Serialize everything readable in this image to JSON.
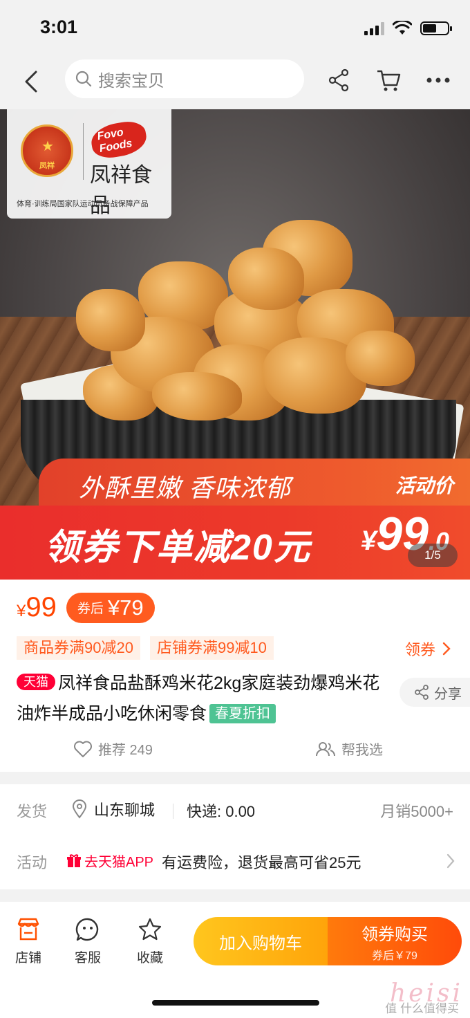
{
  "status_bar": {
    "time": "3:01",
    "battery_level": 0.55
  },
  "nav": {
    "search_placeholder": "搜索宝贝"
  },
  "icons": {
    "back": "chevron-left-icon",
    "search": "search-icon",
    "share": "share-icon",
    "cart": "cart-icon",
    "more": "more-icon"
  },
  "hero": {
    "brand_logo_en": "Fovo Foods",
    "brand_emblem_text": "凤祥",
    "brand_name": "凤祥食品",
    "brand_tagline": "体育·训练局国家队运动员备战保障产品",
    "slogan": "外酥里嫩 香味浓郁",
    "promo_label": "活动价",
    "coupon_text": "领券下单减20元",
    "promo_price": {
      "currency": "¥",
      "integer": "99",
      "decimal": ".0"
    },
    "image_counter": "1/5"
  },
  "price": {
    "currency": "¥",
    "value": "99",
    "after_coupon_label": "券后",
    "after_coupon_value": "¥79"
  },
  "coupons": {
    "tags": [
      "商品券满90减20",
      "店铺券满99减10"
    ],
    "get_label": "领券"
  },
  "product": {
    "platform_badge": "天猫",
    "title": "凤祥食品盐酥鸡米花2kg家庭装劲爆鸡米花油炸半成品小吃休闲零食",
    "season_badge": "春夏折扣",
    "share_label": "分享",
    "recommend_label": "推荐 249",
    "help_choose_label": "帮我选"
  },
  "shipping": {
    "label": "发货",
    "location": "山东聊城",
    "fee": "快递: 0.00",
    "monthly_sales": "月销5000+"
  },
  "activity": {
    "label": "活动",
    "link": "去天猫APP",
    "desc": "有运费险，退货最高可省25元"
  },
  "bottom_bar": {
    "store_label": "店铺",
    "service_label": "客服",
    "favorite_label": "收藏",
    "add_cart_label": "加入购物车",
    "buy_label": "领券购买",
    "buy_sub": "券后￥79"
  },
  "watermark": {
    "big": "heisi",
    "small": "值 什么值得买"
  },
  "colors": {
    "accent": "#ff4400",
    "tmall": "#ff0036",
    "coupon_bg": "#fff1e8",
    "season": "#4ec393"
  }
}
